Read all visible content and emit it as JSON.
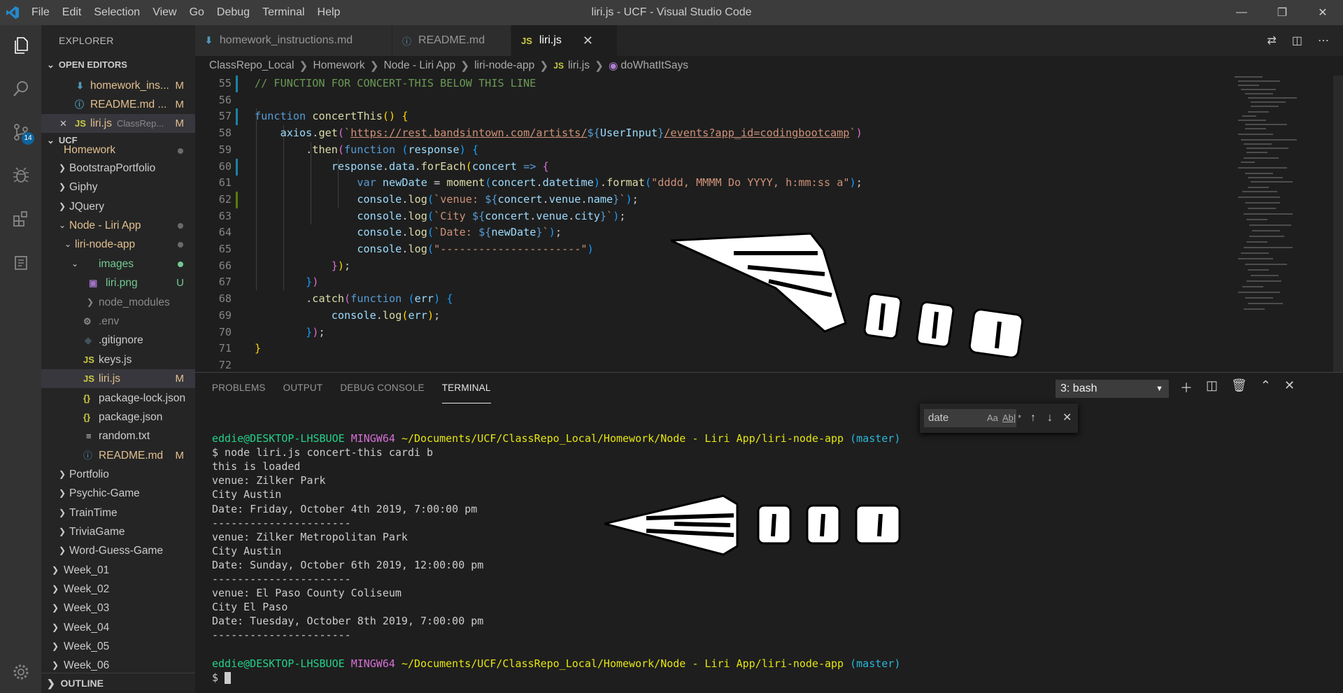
{
  "window": {
    "title": "liri.js - UCF - Visual Studio Code",
    "menu": [
      "File",
      "Edit",
      "Selection",
      "View",
      "Go",
      "Debug",
      "Terminal",
      "Help"
    ]
  },
  "activity": {
    "items": [
      "files-icon",
      "search-icon",
      "source-control-icon",
      "debug-icon",
      "extensions-icon",
      "remote-icon"
    ],
    "scm_badge": "14"
  },
  "sidebar": {
    "title": "EXPLORER",
    "open_editors_label": "OPEN EDITORS",
    "open_editors": [
      {
        "name": "homework_ins...",
        "status": "M"
      },
      {
        "name": "README.md ...",
        "status": "M"
      },
      {
        "name": "liri.js",
        "desc": "ClassRep...",
        "status": "M"
      }
    ],
    "workspace_label": "UCF",
    "tree": [
      {
        "name": "Homework"
      },
      {
        "name": "BootstrapPortfolio"
      },
      {
        "name": "Giphy"
      },
      {
        "name": "JQuery"
      },
      {
        "name": "Node - Liri App"
      },
      {
        "name": "liri-node-app"
      },
      {
        "name": "images"
      },
      {
        "name": "liri.png",
        "status": "U"
      },
      {
        "name": "node_modules"
      },
      {
        "name": ".env"
      },
      {
        "name": ".gitignore"
      },
      {
        "name": "keys.js"
      },
      {
        "name": "liri.js",
        "status": "M"
      },
      {
        "name": "package-lock.json"
      },
      {
        "name": "package.json"
      },
      {
        "name": "random.txt"
      },
      {
        "name": "README.md",
        "status": "M"
      },
      {
        "name": "Portfolio"
      },
      {
        "name": "Psychic-Game"
      },
      {
        "name": "TrainTime"
      },
      {
        "name": "TriviaGame"
      },
      {
        "name": "Word-Guess-Game"
      },
      {
        "name": "Week_01"
      },
      {
        "name": "Week_02"
      },
      {
        "name": "Week_03"
      },
      {
        "name": "Week_04"
      },
      {
        "name": "Week_05"
      },
      {
        "name": "Week_06"
      }
    ],
    "outline_label": "OUTLINE"
  },
  "tabs": [
    {
      "label": "homework_instructions.md",
      "icon": "markdown-icon"
    },
    {
      "label": "README.md",
      "icon": "info-icon"
    },
    {
      "label": "liri.js",
      "icon": "js-icon",
      "active": true
    }
  ],
  "breadcrumb": [
    "ClassRepo_Local",
    "Homework",
    "Node - Liri App",
    "liri-node-app",
    "liri.js",
    "doWhatItSays"
  ],
  "editor": {
    "line_numbers": [
      "55",
      "56",
      "57",
      "58",
      "59",
      "60",
      "61",
      "62",
      "63",
      "64",
      "65",
      "66",
      "67",
      "68",
      "69",
      "70",
      "71",
      "72"
    ]
  },
  "panel": {
    "tabs": [
      "PROBLEMS",
      "OUTPUT",
      "DEBUG CONSOLE",
      "TERMINAL"
    ],
    "terminal_select": "3: bash",
    "find_value": "date",
    "find_options": [
      "Aa",
      "Ab|",
      "*"
    ]
  },
  "terminal": {
    "prompt_user": "eddie@DESKTOP-LHSBUOE",
    "prompt_env": "MINGW64",
    "prompt_path": "~/Documents/UCF/ClassRepo_Local/Homework/Node - Liri App/liri-node-app",
    "prompt_branch": "(master)",
    "command": "$ node liri.js concert-this cardi b",
    "output": [
      "this is loaded",
      "venue: Zilker Park",
      "City Austin",
      "Date: Friday, October 4th 2019, 7:00:00 pm",
      "----------------------",
      "venue: Zilker Metropolitan Park",
      "City Austin",
      "Date: Sunday, October 6th 2019, 12:00:00 pm",
      "----------------------",
      "venue: El Paso County Coliseum",
      "City El Paso",
      "Date: Tuesday, October 8th 2019, 7:00:00 pm",
      "----------------------"
    ],
    "final_prompt": "$"
  }
}
